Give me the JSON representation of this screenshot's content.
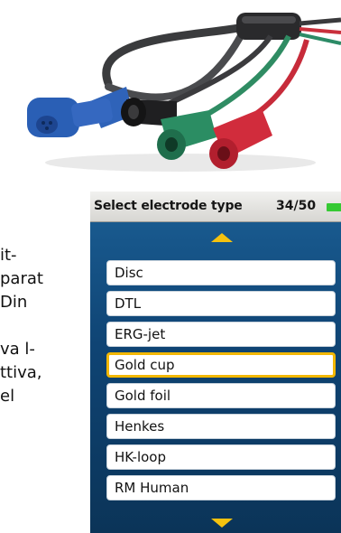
{
  "body_text": [
    "it-",
    "parat",
    "Din",
    "",
    "va l-",
    "ttiva,",
    "el"
  ],
  "device": {
    "header_title": "Select electrode type",
    "header_count": "34/50",
    "battery_color": "#35c933",
    "accent_color": "#f5c20f",
    "items": [
      {
        "label": "Disc",
        "selected": false
      },
      {
        "label": "DTL",
        "selected": false
      },
      {
        "label": "ERG-jet",
        "selected": false
      },
      {
        "label": "Gold cup",
        "selected": true
      },
      {
        "label": "Gold foil",
        "selected": false
      },
      {
        "label": "Henkes",
        "selected": false
      },
      {
        "label": "HK-loop",
        "selected": false
      },
      {
        "label": "RM Human",
        "selected": false
      }
    ]
  }
}
